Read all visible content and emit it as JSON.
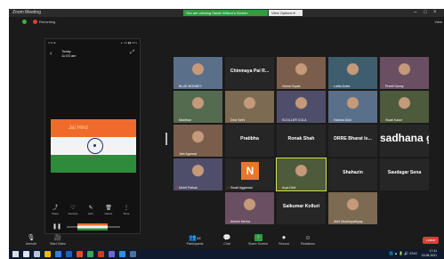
{
  "titlebar": {
    "app": "Zoom Meeting",
    "share_banner": "You are viewing Sarah Wilson's Screen",
    "view_options": "View Options ▾",
    "minimize": "–",
    "maximize": "□",
    "close": "×"
  },
  "topstrip": {
    "recording": "Recording",
    "view": "View"
  },
  "phone": {
    "status_left": "9:41 ■",
    "status_right": "▲ 4G ▮▮ 64%",
    "title": "Today",
    "subtitle": "11:03 am",
    "flag_text": "Jai Hind",
    "tools": [
      "Share",
      "Favorite",
      "Edit",
      "Delete",
      "More"
    ]
  },
  "participants": [
    {
      "name": "BLUE MONKEY"
    },
    {
      "name": "Chinmaya Pal R..."
    },
    {
      "name": "Vishal Gupta"
    },
    {
      "name": "Lalita Dutta"
    },
    {
      "name": "Preeti Sonny"
    },
    {
      "name": "Manthan"
    },
    {
      "name": "Devi Sethi"
    },
    {
      "name": "SCOLLER COLA"
    },
    {
      "name": "Harsha Dixit"
    },
    {
      "name": "Swati Katuri"
    },
    {
      "name": "Jiah Agarwal"
    },
    {
      "name": "Pratibha"
    },
    {
      "name": "Ronak Shah"
    },
    {
      "name": "DRRE Bharat le..."
    },
    {
      "name": "sadhana gupta"
    },
    {
      "name": "Mohit Pathak"
    },
    {
      "name": "Swati Aggarwal",
      "initial": "N"
    },
    {
      "name": "Arya Dixit"
    },
    {
      "name": "Shahazin"
    },
    {
      "name": "Saudagar Sena"
    },
    {
      "name": "Ashish Mehra"
    },
    {
      "name": "Saikumar Kolluri"
    },
    {
      "name": "Abhi Mukhopadhyay"
    },
    {
      "name": "S"
    }
  ],
  "toolbar": {
    "mute": "Unmute",
    "video": "Start Video",
    "participants": "Participants",
    "participants_count": "24",
    "chat": "Chat",
    "share": "Share Screen",
    "record": "Record",
    "reactions": "Reactions",
    "end": "Leave"
  },
  "taskbar": {
    "time": "17:41",
    "date": "13-08-2021",
    "lang": "ENG"
  }
}
